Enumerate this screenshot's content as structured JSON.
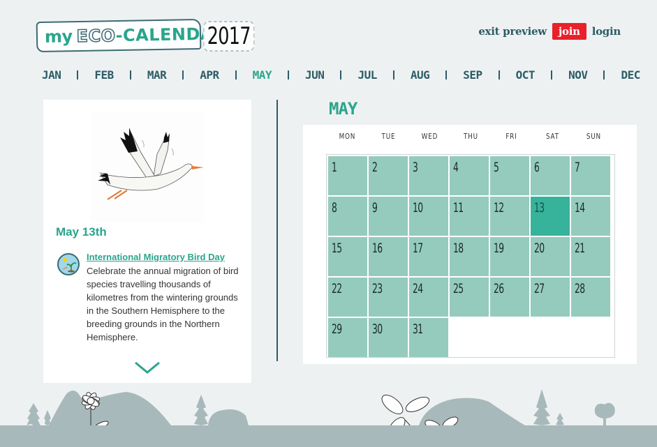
{
  "header": {
    "logo": {
      "my": "my",
      "eco": "ECO",
      "dash": "-",
      "calendar": "CALENDAR",
      "year": "2017"
    },
    "links": [
      {
        "label": "exit preview"
      },
      {
        "label": "join"
      },
      {
        "label": "login"
      }
    ],
    "colors": {
      "accent": "#2aa58c",
      "dark": "#2c5c66",
      "join_bg": "#e8212a"
    }
  },
  "months": [
    {
      "label": "JAN"
    },
    {
      "label": "FEB"
    },
    {
      "label": "MAR"
    },
    {
      "label": "APR"
    },
    {
      "label": "MAY",
      "active": true
    },
    {
      "label": "JUN"
    },
    {
      "label": "JUL"
    },
    {
      "label": "AUG"
    },
    {
      "label": "SEP"
    },
    {
      "label": "OCT"
    },
    {
      "label": "NOV"
    },
    {
      "label": "DEC"
    }
  ],
  "event": {
    "image": "stork-illustration",
    "date": "May 13th",
    "icon": "migratory-bird-day-icon",
    "title": "International Migratory Bird Day",
    "description": "Celebrate the annual migration of bird species travelling thousands of kilometres from the wintering grounds in the Southern Hemisphere to the breeding grounds in the Northern Hemisphere.",
    "more_icon": "chevron-down-icon"
  },
  "calendar": {
    "month": "MAY",
    "weekdays": [
      "MON",
      "TUE",
      "WED",
      "THU",
      "FRI",
      "SAT",
      "SUN"
    ],
    "days": [
      "1",
      "2",
      "3",
      "4",
      "5",
      "6",
      "7",
      "8",
      "9",
      "10",
      "11",
      "12",
      "13",
      "14",
      "15",
      "16",
      "17",
      "18",
      "19",
      "20",
      "21",
      "22",
      "23",
      "24",
      "25",
      "26",
      "27",
      "28",
      "29",
      "30",
      "31"
    ],
    "selected_day": "13",
    "colors": {
      "day": "#94cbbc",
      "selected": "#36b39a"
    }
  }
}
